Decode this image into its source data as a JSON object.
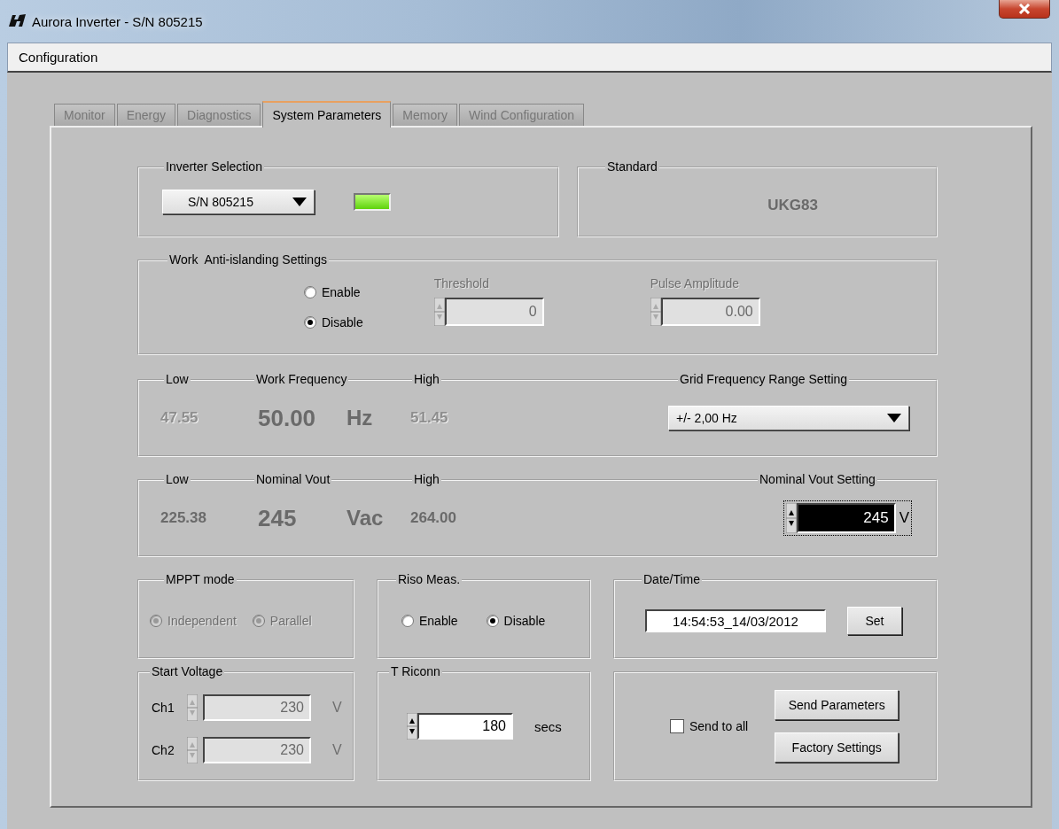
{
  "window": {
    "title": "Aurora Inverter - S/N 805215"
  },
  "menu": [
    {
      "label": "Configuration"
    }
  ],
  "tabs": [
    {
      "label": "Monitor",
      "selected": false
    },
    {
      "label": "Energy",
      "selected": false
    },
    {
      "label": "Diagnostics",
      "selected": false
    },
    {
      "label": "System Parameters",
      "selected": true
    },
    {
      "label": "Memory",
      "selected": false
    },
    {
      "label": "Wind Configuration",
      "selected": false
    }
  ],
  "inverter_selection": {
    "label": "Inverter Selection",
    "value": "S/N 805215",
    "led_on": true
  },
  "standard": {
    "label": "Standard",
    "value": "UKG83"
  },
  "anti_islanding": {
    "label": "Work  Anti-islanding Settings",
    "options": [
      {
        "label": "Enable",
        "selected": false
      },
      {
        "label": "Disable",
        "selected": true
      }
    ],
    "fields": [
      {
        "label": "Threshold",
        "value": "0",
        "disabled": true
      },
      {
        "label": "Pulse Amplitude",
        "value": "0.00",
        "disabled": true
      }
    ]
  },
  "work_frequency": {
    "low_label": "Low",
    "low": "47.55",
    "title": "Work Frequency",
    "value": "50.00",
    "unit": "Hz",
    "high_label": "High",
    "high": "51.45",
    "limits_disabled": true,
    "setting": {
      "kind": "dropdown",
      "label": "Grid Frequency Range Setting",
      "value": "+/-  2,00 Hz",
      "focused": false
    }
  },
  "nominal_vout": {
    "low_label": "Low",
    "low": "225.38",
    "title": "Nominal Vout",
    "value": "245",
    "unit": "Vac",
    "high_label": "High",
    "high": "264.00",
    "limits_disabled": false,
    "setting": {
      "kind": "spin",
      "label": "Nominal Vout Setting",
      "value": "245",
      "unit": "V",
      "focused": true
    }
  },
  "mppt": {
    "label": "MPPT mode",
    "disabled": true,
    "options": [
      {
        "label": "Independent",
        "selected": true
      },
      {
        "label": "Parallel",
        "selected": true
      }
    ]
  },
  "riso": {
    "label": "Riso Meas.",
    "options": [
      {
        "label": "Enable",
        "selected": false
      },
      {
        "label": "Disable",
        "selected": true
      }
    ]
  },
  "date_time": {
    "label": "Date/Time",
    "value": "14:54:53_14/03/2012",
    "button": "Set"
  },
  "start_voltage": {
    "label": "Start Voltage",
    "disabled": true,
    "channels": [
      {
        "label": "Ch1",
        "value": "230",
        "unit": "V"
      },
      {
        "label": "Ch2",
        "value": "230",
        "unit": "V"
      }
    ]
  },
  "t_riconn": {
    "label": "T Riconn",
    "value": "180",
    "unit": "secs"
  },
  "send": {
    "checkbox": {
      "label": "Send to all",
      "checked": false
    },
    "buttons": [
      "Send Parameters",
      "Factory Settings"
    ]
  }
}
